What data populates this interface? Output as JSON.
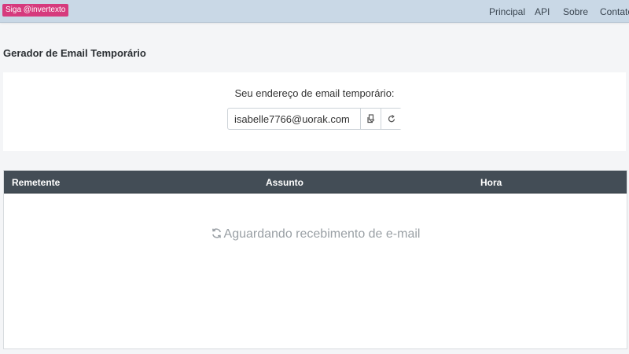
{
  "navbar": {
    "badge": "Siga @invertexto",
    "links": [
      "Principal",
      "API",
      "Sobre",
      "Contato"
    ]
  },
  "page": {
    "title": "Gerador de Email Temporário"
  },
  "email_card": {
    "caption": "Seu endereço de email temporário:",
    "email_value": "isabelle7766@uorak.com",
    "copy_icon": "copy-icon",
    "refresh_icon": "refresh-icon"
  },
  "inbox": {
    "columns": [
      "Remetente",
      "Assunto",
      "Hora"
    ],
    "empty_message": "Aguardando recebimento de e-mail",
    "empty_icon": "sync-icon"
  },
  "colors": {
    "navbar_bg": "#c9d8e6",
    "badge_bg": "#d63a7d",
    "table_header_bg": "#434d56"
  }
}
